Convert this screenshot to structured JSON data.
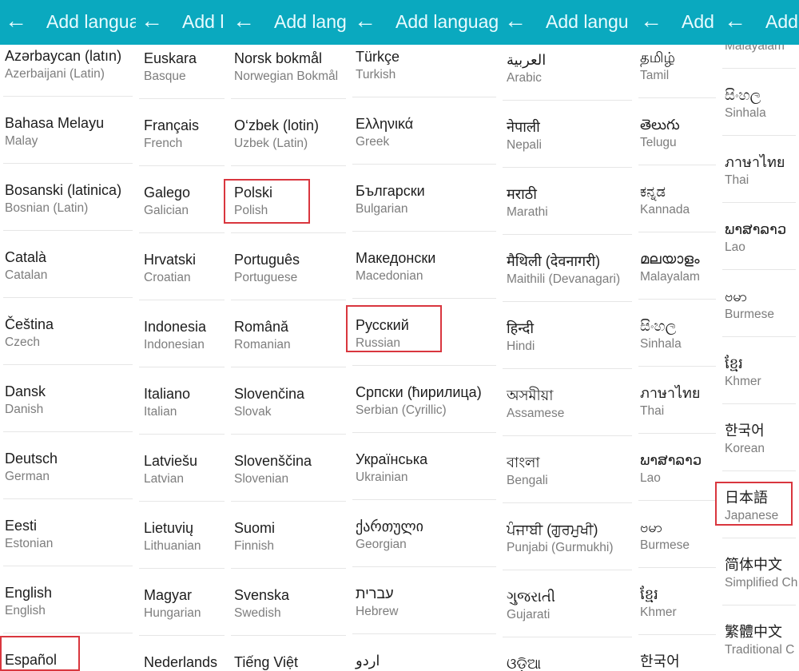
{
  "header": {
    "title": "Add language",
    "back_icon": "arrow-left-icon",
    "color": "#0aa9bf"
  },
  "highlight_color": "#d9363e",
  "columns": [
    {
      "title": "Add langua",
      "items": [
        {
          "name": "Azərbaycan (latın)",
          "sub": "Azerbaijani (Latin)"
        },
        {
          "name": "Bahasa Melayu",
          "sub": "Malay"
        },
        {
          "name": "Bosanski (latinica)",
          "sub": "Bosnian (Latin)"
        },
        {
          "name": "Català",
          "sub": "Catalan"
        },
        {
          "name": "Čeština",
          "sub": "Czech"
        },
        {
          "name": "Dansk",
          "sub": "Danish"
        },
        {
          "name": "Deutsch",
          "sub": "German"
        },
        {
          "name": "Eesti",
          "sub": "Estonian"
        },
        {
          "name": "English",
          "sub": "English"
        },
        {
          "name": "Español",
          "sub": "",
          "highlighted": true
        }
      ]
    },
    {
      "title": "Add l",
      "items": [
        {
          "name": "Euskara",
          "sub": "Basque"
        },
        {
          "name": "Français",
          "sub": "French"
        },
        {
          "name": "Galego",
          "sub": "Galician"
        },
        {
          "name": "Hrvatski",
          "sub": "Croatian"
        },
        {
          "name": "Indonesia",
          "sub": "Indonesian"
        },
        {
          "name": "Italiano",
          "sub": "Italian"
        },
        {
          "name": "Latviešu",
          "sub": "Latvian"
        },
        {
          "name": "Lietuvių",
          "sub": "Lithuanian"
        },
        {
          "name": "Magyar",
          "sub": "Hungarian"
        },
        {
          "name": "Nederlands",
          "sub": ""
        }
      ]
    },
    {
      "title": "Add lang",
      "items": [
        {
          "name": "Norsk bokmål",
          "sub": "Norwegian Bokmål"
        },
        {
          "name": "O‘zbek (lotin)",
          "sub": "Uzbek (Latin)"
        },
        {
          "name": "Polski",
          "sub": "Polish",
          "highlighted": true
        },
        {
          "name": "Português",
          "sub": "Portuguese"
        },
        {
          "name": "Română",
          "sub": "Romanian"
        },
        {
          "name": "Slovenčina",
          "sub": "Slovak"
        },
        {
          "name": "Slovenščina",
          "sub": "Slovenian"
        },
        {
          "name": "Suomi",
          "sub": "Finnish"
        },
        {
          "name": "Svenska",
          "sub": "Swedish"
        },
        {
          "name": "Tiếng Việt",
          "sub": ""
        }
      ]
    },
    {
      "title": "Add languag",
      "items": [
        {
          "name": "Türkçe",
          "sub": "Turkish"
        },
        {
          "name": "Ελληνικά",
          "sub": "Greek"
        },
        {
          "name": "Български",
          "sub": "Bulgarian"
        },
        {
          "name": "Македонски",
          "sub": "Macedonian"
        },
        {
          "name": "Русский",
          "sub": "Russian",
          "highlighted": true
        },
        {
          "name": "Српски (ћирилица)",
          "sub": "Serbian (Cyrillic)"
        },
        {
          "name": "Українська",
          "sub": "Ukrainian"
        },
        {
          "name": "ქართული",
          "sub": "Georgian"
        },
        {
          "name": "עברית",
          "sub": "Hebrew"
        },
        {
          "name": "اردو",
          "sub": ""
        }
      ]
    },
    {
      "title": "Add langu",
      "items": [
        {
          "name": "العربية",
          "sub": "Arabic"
        },
        {
          "name": "नेपाली",
          "sub": "Nepali"
        },
        {
          "name": "मराठी",
          "sub": "Marathi"
        },
        {
          "name": "मैथिली (देवनागरी)",
          "sub": "Maithili (Devanagari)"
        },
        {
          "name": "हिन्दी",
          "sub": "Hindi"
        },
        {
          "name": "অসমীয়া",
          "sub": "Assamese"
        },
        {
          "name": "বাংলা",
          "sub": "Bengali"
        },
        {
          "name": "ਪੰਜਾਬੀ (ਗੁਰਮੁਖੀ)",
          "sub": "Punjabi (Gurmukhi)"
        },
        {
          "name": "ગુજરાતી",
          "sub": "Gujarati"
        },
        {
          "name": "ଓଡ଼ିଆ",
          "sub": ""
        }
      ]
    },
    {
      "title": "Add",
      "items": [
        {
          "name": "தமிழ்",
          "sub": "Tamil"
        },
        {
          "name": "తెలుగు",
          "sub": "Telugu"
        },
        {
          "name": "ಕನ್ನಡ",
          "sub": "Kannada"
        },
        {
          "name": "മലയാളം",
          "sub": "Malayalam"
        },
        {
          "name": "සිංහල",
          "sub": "Sinhala"
        },
        {
          "name": "ภาษาไทย",
          "sub": "Thai"
        },
        {
          "name": "ພາສາລາວ",
          "sub": "Lao"
        },
        {
          "name": "ဗမာ",
          "sub": "Burmese"
        },
        {
          "name": "ខ្មែរ",
          "sub": "Khmer"
        },
        {
          "name": "한국어",
          "sub": ""
        }
      ]
    },
    {
      "title": "Add",
      "items": [
        {
          "name": "",
          "sub": "Malayalam"
        },
        {
          "name": "සිංහල",
          "sub": "Sinhala"
        },
        {
          "name": "ภาษาไทย",
          "sub": "Thai"
        },
        {
          "name": "ພາສາລາວ",
          "sub": "Lao"
        },
        {
          "name": "ဗမာ",
          "sub": "Burmese"
        },
        {
          "name": "ខ្មែរ",
          "sub": "Khmer"
        },
        {
          "name": "한국어",
          "sub": "Korean"
        },
        {
          "name": "日本語",
          "sub": "Japanese",
          "highlighted": true
        },
        {
          "name": "简体中文",
          "sub": "Simplified Ch"
        },
        {
          "name": "繁體中文",
          "sub": "Traditional C"
        }
      ]
    }
  ]
}
